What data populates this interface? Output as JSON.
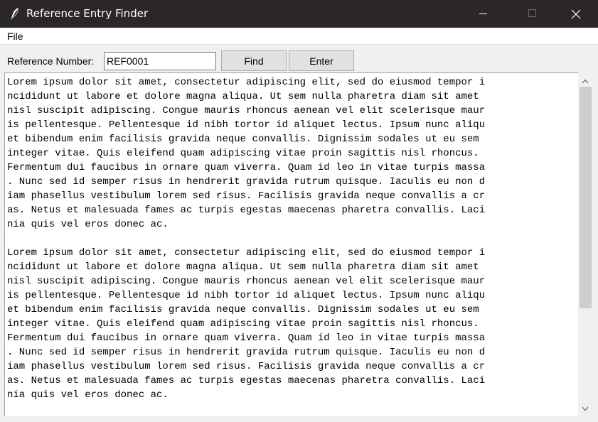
{
  "window": {
    "title": "Reference Entry Finder"
  },
  "menu": {
    "items": [
      "File"
    ]
  },
  "form": {
    "label": "Reference Number:",
    "value": "REF0001",
    "find_label": "Find",
    "enter_label": "Enter"
  },
  "text": {
    "lines": [
      "Lorem ipsum dolor sit amet, consectetur adipiscing elit, sed do eiusmod tempor i",
      "ncididunt ut labore et dolore magna aliqua. Ut sem nulla pharetra diam sit amet",
      "nisl suscipit adipiscing. Congue mauris rhoncus aenean vel elit scelerisque maur",
      "is pellentesque. Pellentesque id nibh tortor id aliquet lectus. Ipsum nunc aliqu",
      "et bibendum enim facilisis gravida neque convallis. Dignissim sodales ut eu sem",
      "integer vitae. Quis eleifend quam adipiscing vitae proin sagittis nisl rhoncus.",
      "Fermentum dui faucibus in ornare quam viverra. Quam id leo in vitae turpis massa",
      ". Nunc sed id semper risus in hendrerit gravida rutrum quisque. Iaculis eu non d",
      "iam phasellus vestibulum lorem sed risus. Facilisis gravida neque convallis a cr",
      "as. Netus et malesuada fames ac turpis egestas maecenas pharetra convallis. Laci",
      "nia quis vel eros donec ac.",
      "",
      "Lorem ipsum dolor sit amet, consectetur adipiscing elit, sed do eiusmod tempor i",
      "ncididunt ut labore et dolore magna aliqua. Ut sem nulla pharetra diam sit amet",
      "nisl suscipit adipiscing. Congue mauris rhoncus aenean vel elit scelerisque maur",
      "is pellentesque. Pellentesque id nibh tortor id aliquet lectus. Ipsum nunc aliqu",
      "et bibendum enim facilisis gravida neque convallis. Dignissim sodales ut eu sem",
      "integer vitae. Quis eleifend quam adipiscing vitae proin sagittis nisl rhoncus.",
      "Fermentum dui faucibus in ornare quam viverra. Quam id leo in vitae turpis massa",
      ". Nunc sed id semper risus in hendrerit gravida rutrum quisque. Iaculis eu non d",
      "iam phasellus vestibulum lorem sed risus. Facilisis gravida neque convallis a cr",
      "as. Netus et malesuada fames ac turpis egestas maecenas pharetra convallis. Laci",
      "nia quis vel eros donec ac."
    ]
  },
  "icons": {
    "app": "feather-icon",
    "minimize": "minimize-icon",
    "maximize": "maximize-icon",
    "close": "close-icon",
    "scroll_up": "chevron-up-icon",
    "scroll_down": "chevron-down-icon"
  },
  "colors": {
    "titlebar": "#2b2726",
    "window_bg": "#f0f0f0",
    "button_bg": "#e1e1e1",
    "scroll_thumb": "#cdcdcd"
  }
}
